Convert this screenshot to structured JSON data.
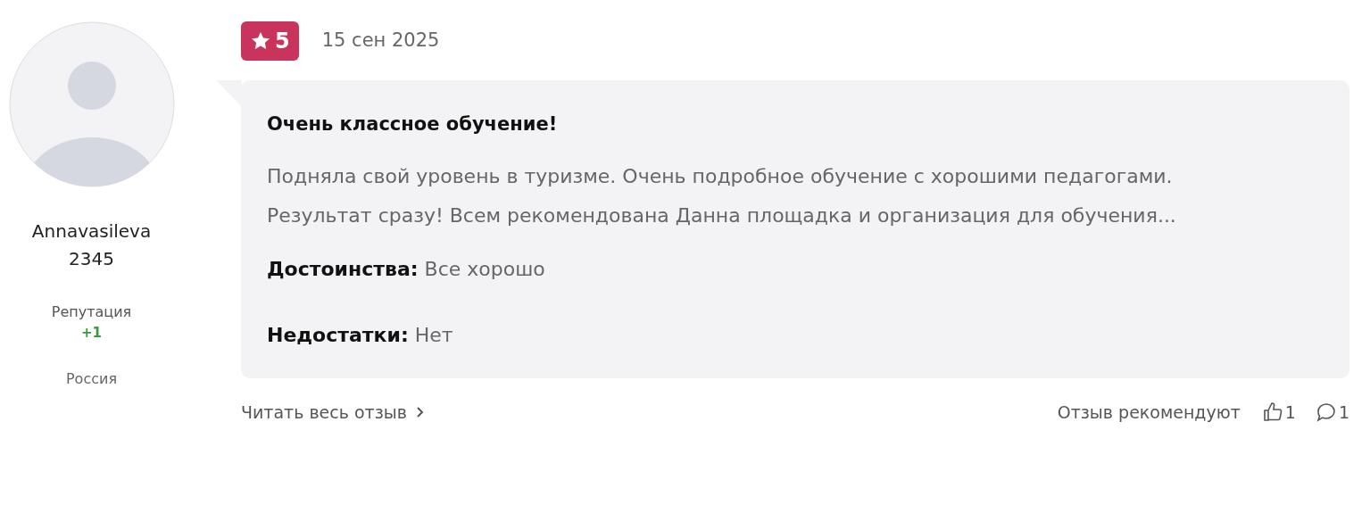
{
  "author": {
    "name": "Annavasileva\n2345",
    "reputation_label": "Репутация",
    "reputation": "+1",
    "country": "Россия"
  },
  "review": {
    "rating": "5",
    "date": "15 сен 2025",
    "title": "Очень классное обучение!",
    "text": "Подняла свой уровень в туризме. Очень подробное обучение с хорошими педагогами. Результат сразу! Всем рекомендована Данна площадка и организация для обучения...",
    "pros_label": "Достоинства:",
    "pros": "Все хорошо",
    "cons_label": "Недостатки:",
    "cons": "Нет"
  },
  "footer": {
    "read_more": "Читать весь отзыв",
    "recommend_label": "Отзыв рекомендуют",
    "likes": "1",
    "comments": "1"
  }
}
